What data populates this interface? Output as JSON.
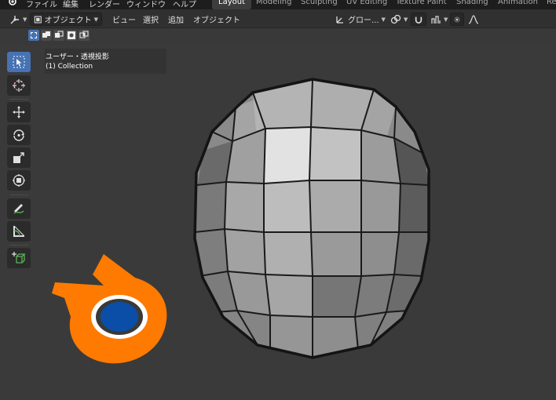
{
  "menubar": {
    "items": [
      "ファイル",
      "編集",
      "レンダー",
      "ウィンドウ",
      "ヘルプ"
    ],
    "workspaces": [
      "Layout",
      "Modeling",
      "Sculpting",
      "UV Editing",
      "Texture Paint",
      "Shading",
      "Animation",
      "Re"
    ],
    "active_workspace": "Layout"
  },
  "header": {
    "mode_label": "オブジェクト",
    "menus": [
      "ビュー",
      "選択",
      "追加",
      "オブジェクト"
    ],
    "transform_orientation": "グロー..."
  },
  "viewport": {
    "view_name": "ユーザー・透視投影",
    "collection": "(1) Collection"
  },
  "toolbar": {
    "tools": [
      {
        "name": "select-box",
        "icon": "select-box-icon",
        "active": true
      },
      {
        "name": "cursor",
        "icon": "cursor-icon",
        "active": false
      },
      {
        "name": "move",
        "icon": "move-icon",
        "active": false
      },
      {
        "name": "rotate",
        "icon": "rotate-icon",
        "active": false
      },
      {
        "name": "scale",
        "icon": "scale-icon",
        "active": false
      },
      {
        "name": "transform",
        "icon": "transform-icon",
        "active": false
      },
      {
        "name": "annotate",
        "icon": "annotate-icon",
        "active": false
      },
      {
        "name": "measure",
        "icon": "measure-icon",
        "active": false
      },
      {
        "name": "add-cube",
        "icon": "add-cube-icon",
        "active": false
      }
    ]
  },
  "colors": {
    "accent": "#4772b3",
    "blender_orange": "#ff7a00",
    "blender_blue": "#0a4ea8",
    "viewport_bg": "#3a3a3a"
  }
}
